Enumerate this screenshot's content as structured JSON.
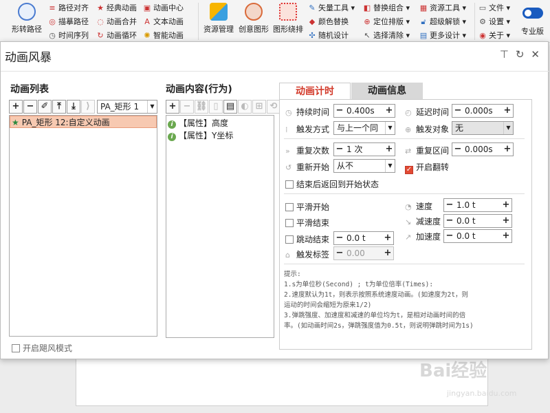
{
  "ribbon": {
    "path_label": "形转路径",
    "items_col1": [
      "路径对齐",
      "描摹路径",
      "时间序列"
    ],
    "items_col2": [
      "经典动画",
      "动画合并",
      "动画循环"
    ],
    "items_col3": [
      "动画中心",
      "文本动画",
      "智能动画"
    ],
    "resource_label": "资源管理",
    "creative_label": "创意图形",
    "shape_label": "图形绕排",
    "items_col4": [
      "矢量工具",
      "颜色替换",
      "随机设计"
    ],
    "items_col5": [
      "替换组合",
      "定位排版",
      "选择清除"
    ],
    "items_col6": [
      "资源工具",
      "超级解锁",
      "更多设计"
    ],
    "items_col7": [
      "文件",
      "设置",
      "关于"
    ],
    "pro_label": "专业版"
  },
  "dialog": {
    "title": "动画风暴",
    "title_icons": [
      "pin-icon",
      "refresh-icon",
      "close-icon"
    ]
  },
  "left": {
    "heading": "动画列表",
    "selector_value": "PA_矩形 1",
    "items": [
      {
        "text": "PA_矩形 12:自定义动画"
      }
    ],
    "storm_mode": "开启飓风模式"
  },
  "middle": {
    "heading": "动画内容(行为)",
    "items": [
      {
        "text": "【属性】高度"
      },
      {
        "text": "【属性】Y坐标"
      }
    ]
  },
  "tabs": {
    "timing": "动画计时",
    "info": "动画信息"
  },
  "timing": {
    "duration_label": "持续时间",
    "duration_value": "0.400s",
    "delay_label": "延迟时间",
    "delay_value": "0.000s",
    "trigger_label": "触发方式",
    "trigger_value": "与上一个同",
    "target_label": "触发对象",
    "target_value": "无",
    "repeat_label": "重复次数",
    "repeat_value": "1 次",
    "interval_label": "重复区间",
    "interval_value": "0.000s",
    "restart_label": "重新开始",
    "restart_value": "从不",
    "flip_label": "开启翻转",
    "return_label": "结束后返回到开始状态",
    "smooth_start_label": "平滑开始",
    "smooth_end_label": "平滑结束",
    "bounce_end_label": "跳动结束",
    "bounce_end_value": "0.0 t",
    "trigger_tag_label": "触发标签",
    "trigger_tag_value": "0.00",
    "speed_label": "速度",
    "speed_value": "1.0 t",
    "decel_label": "减速度",
    "decel_value": "0.0 t",
    "accel_label": "加速度",
    "accel_value": "0.0 t"
  },
  "tips": {
    "title": "提示:",
    "line1": "  1.s为单位秒(Second) ; t为单位倍率(Times):",
    "line2": "  2.速度默认为1t，则表示按照系统速度动画。(如速度为2t，则",
    "line2b": "运动的时间会缩短为原来1/2)",
    "line3": "  3.弹跳强度、加速度和减速的单位均为t，是相对动画时间的倍",
    "line3b": "率。(如动画时间2s，弹跳强度值为0.5t，则说明弹跳时间为1s)"
  }
}
